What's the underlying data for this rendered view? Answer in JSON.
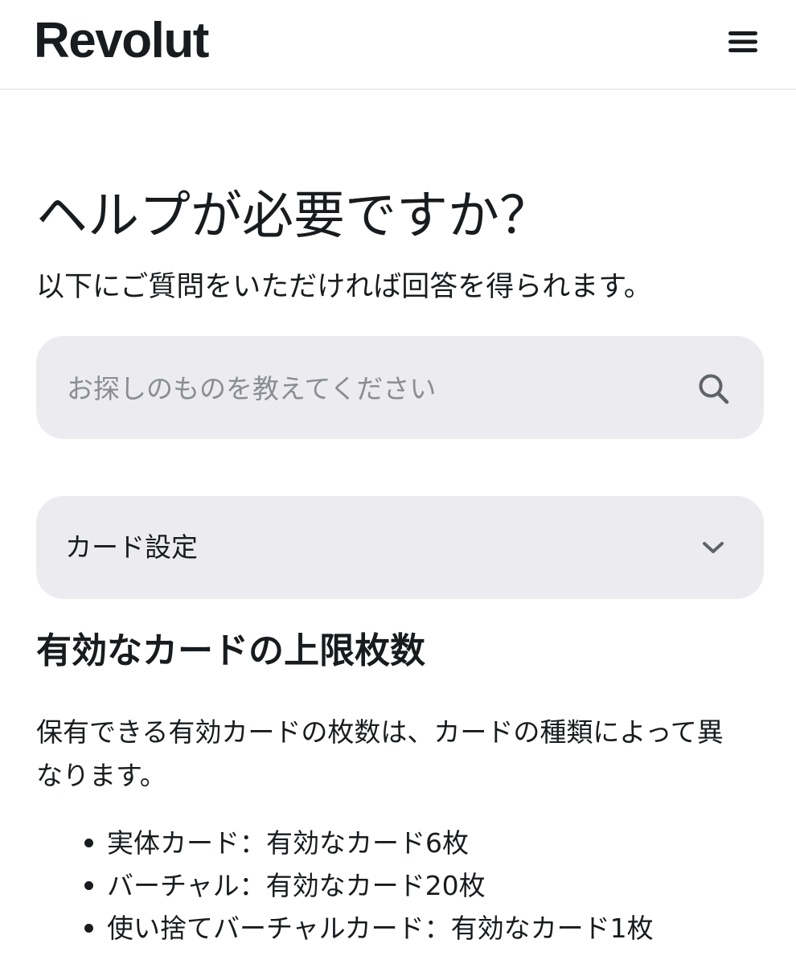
{
  "header": {
    "logo_text": "Revolut",
    "menu_icon": "hamburger-menu-icon"
  },
  "hero": {
    "title": "ヘルプが必要ですか？",
    "subtitle": "以下にご質問をいただければ回答を得られます。"
  },
  "search": {
    "placeholder": "お探しのものを教えてください",
    "value": "",
    "icon": "search-icon"
  },
  "category_select": {
    "selected": "カード設定",
    "icon": "chevron-down-icon"
  },
  "article": {
    "heading": "有効なカードの上限枚数",
    "body": "保有できる有効カードの枚数は、カードの種類によって異なります。",
    "items": [
      "実体カード：有効なカード6枚",
      "バーチャル：有効なカード20枚",
      "使い捨てバーチャルカード：有効なカード1枚"
    ]
  }
}
